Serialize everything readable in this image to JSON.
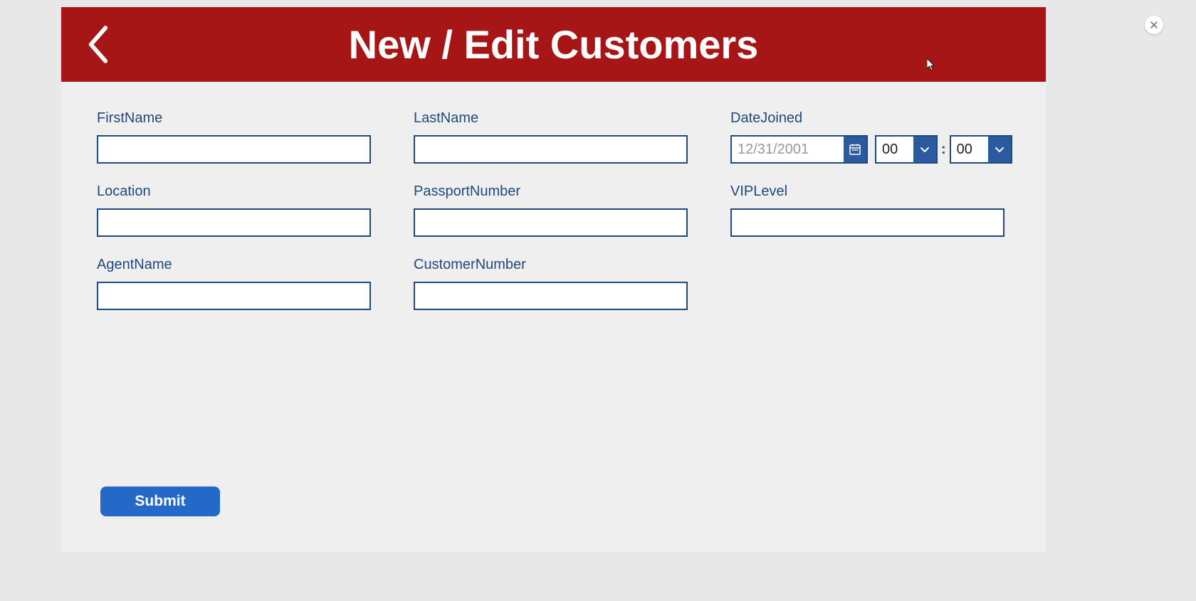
{
  "header": {
    "title": "New / Edit Customers"
  },
  "form": {
    "firstName": {
      "label": "FirstName",
      "value": ""
    },
    "lastName": {
      "label": "LastName",
      "value": ""
    },
    "dateJoined": {
      "label": "DateJoined",
      "dateValue": "12/31/2001",
      "hour": "00",
      "minute": "00"
    },
    "location": {
      "label": "Location",
      "value": ""
    },
    "passportNumber": {
      "label": "PassportNumber",
      "value": ""
    },
    "vipLevel": {
      "label": "VIPLevel",
      "value": ""
    },
    "agentName": {
      "label": "AgentName",
      "value": ""
    },
    "customerNumber": {
      "label": "CustomerNumber",
      "value": ""
    }
  },
  "actions": {
    "submitLabel": "Submit"
  }
}
